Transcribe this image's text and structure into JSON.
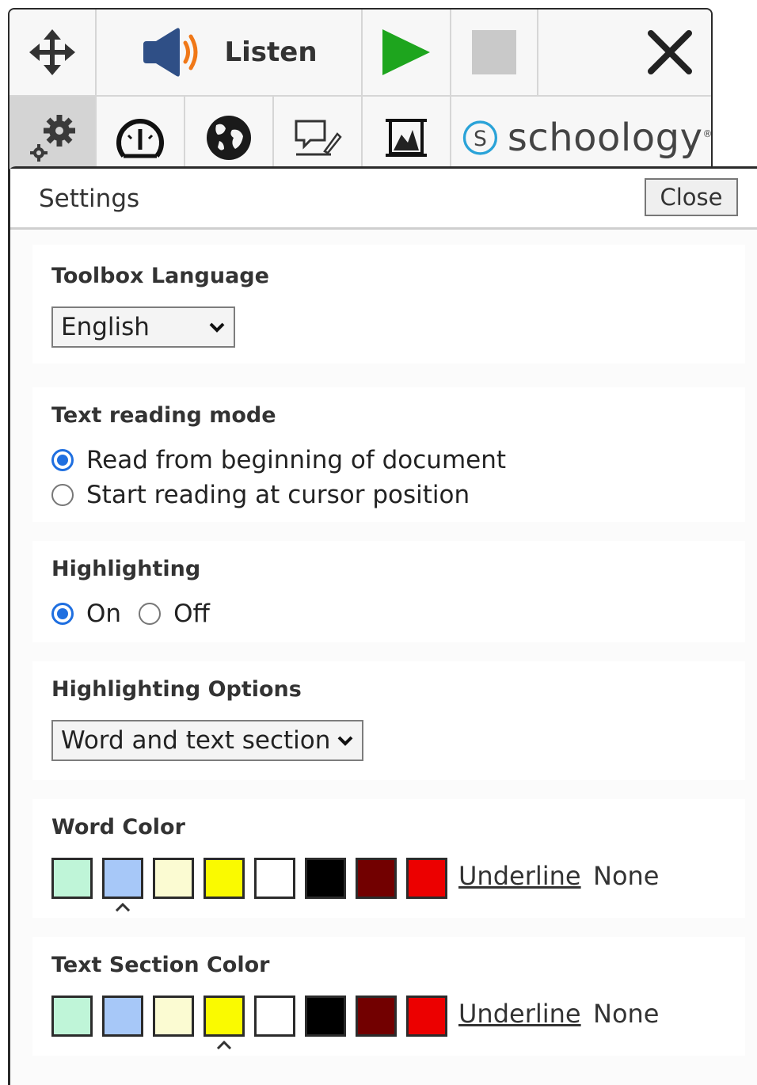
{
  "toolbar": {
    "listen_label": "Listen",
    "brand": "schoology",
    "brand_mark": "S",
    "brand_trademark": "®",
    "icons": [
      "move-icon",
      "speaker-icon",
      "play-icon",
      "stop-icon",
      "close-icon",
      "settings-gear-icon",
      "speed-gauge-icon",
      "globe-icon",
      "annotate-icon",
      "picture-dictionary-icon",
      "schoology-logo"
    ],
    "colors": {
      "play": "#1ea51e",
      "speaker_body": "#2f4f86",
      "speaker_waves": "#f07818",
      "stop": "#c9c9c9",
      "brand_blue": "#2aa3d8"
    }
  },
  "settings": {
    "title": "Settings",
    "close_label": "Close",
    "toolbox_language": {
      "title": "Toolbox Language",
      "selected": "English"
    },
    "reading_mode": {
      "title": "Text reading mode",
      "options": [
        "Read from beginning of document",
        "Start reading at cursor position"
      ],
      "selected_index": 0
    },
    "highlighting": {
      "title": "Highlighting",
      "options": [
        "On",
        "Off"
      ],
      "selected_index": 0
    },
    "highlighting_options": {
      "title": "Highlighting Options",
      "selected": "Word and text section"
    },
    "word_color": {
      "title": "Word Color",
      "swatches": [
        "#bff5d8",
        "#a7c8f8",
        "#fbfbd2",
        "#fafa00",
        "#ffffff",
        "#000000",
        "#720000",
        "#ec0000"
      ],
      "selected_index": 1,
      "underline_label": "Underline",
      "none_label": "None"
    },
    "text_section_color": {
      "title": "Text Section Color",
      "swatches": [
        "#bff5d8",
        "#a7c8f8",
        "#fbfbd2",
        "#fafa00",
        "#ffffff",
        "#000000",
        "#720000",
        "#ec0000"
      ],
      "selected_index": 3,
      "underline_label": "Underline",
      "none_label": "None"
    },
    "accent_color": "#1f6fe0"
  }
}
